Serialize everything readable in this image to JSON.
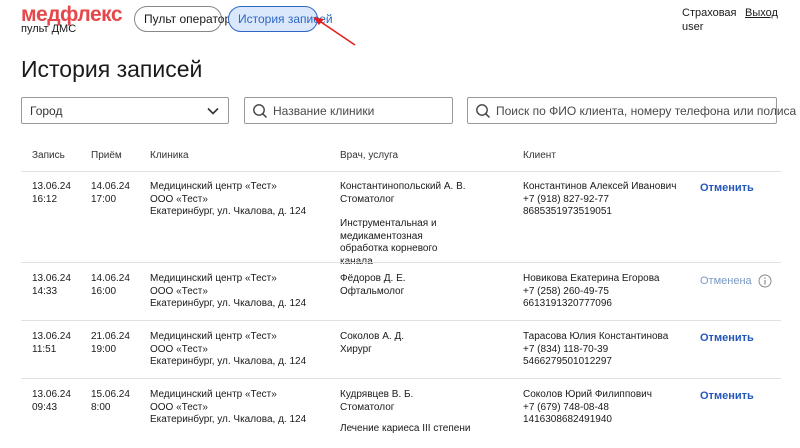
{
  "logo": {
    "main": "медфлекс",
    "sub": "пульт ДМС"
  },
  "nav": {
    "operator": "Пульт оператора",
    "history": "История записей"
  },
  "user": {
    "line1": "Страховая",
    "line2": "user",
    "logout": "Выход"
  },
  "page": {
    "title": "История записей"
  },
  "filters": {
    "city": "Город",
    "clinic_placeholder": "Название клиники",
    "search_placeholder": "Поиск по ФИО клиента, номеру телефона или полиса"
  },
  "table": {
    "headers": {
      "record": "Запись",
      "appointment": "Приём",
      "clinic": "Клиника",
      "doctor": "Врач, услуга",
      "client": "Клиент"
    },
    "rows": [
      {
        "rec_date": "13.06.24",
        "rec_time": "16:12",
        "app_date": "14.06.24",
        "app_time": "17:00",
        "clinic_name": "Медицинский центр «Тест»",
        "clinic_org": "ООО «Тест»",
        "clinic_addr": "Екатеринбург, ул. Чкалова, д. 124",
        "doctor": "Константинопольский А. В.",
        "specialty": "Стоматолог",
        "service": "Инструментальная и медикаментозная обработка корневого канала",
        "client_name": "Константинов Алексей Иванович",
        "client_phone": "+7 (918) 827-92-77",
        "client_policy": "8685351973519051",
        "action": "Отменить"
      },
      {
        "rec_date": "13.06.24",
        "rec_time": "14:33",
        "app_date": "14.06.24",
        "app_time": "16:00",
        "clinic_name": "Медицинский центр «Тест»",
        "clinic_org": "ООО «Тест»",
        "clinic_addr": "Екатеринбург, ул. Чкалова, д. 124",
        "doctor": "Фёдоров Д. Е.",
        "specialty": "Офтальмолог",
        "client_name": "Новикова Екатерина Егорова",
        "client_phone": "+7 (258) 260-49-75",
        "client_policy": "6613191320777096",
        "status": "Отменена"
      },
      {
        "rec_date": "13.06.24",
        "rec_time": "11:51",
        "app_date": "21.06.24",
        "app_time": "19:00",
        "clinic_name": "Медицинский центр «Тест»",
        "clinic_org": "ООО «Тест»",
        "clinic_addr": "Екатеринбург, ул. Чкалова, д. 124",
        "doctor": "Соколов А. Д.",
        "specialty": "Хирург",
        "client_name": "Тарасова Юлия Константинова",
        "client_phone": "+7 (834) 118-70-39",
        "client_policy": "5466279501012297",
        "action": "Отменить"
      },
      {
        "rec_date": "13.06.24",
        "rec_time": "09:43",
        "app_date": "15.06.24",
        "app_time": "8:00",
        "clinic_name": "Медицинский центр «Тест»",
        "clinic_org": "ООО «Тест»",
        "clinic_addr": "Екатеринбург, ул. Чкалова, д. 124",
        "doctor": "Кудрявцев В. Б.",
        "specialty": "Стоматолог",
        "service": "Лечение кариеса III степени",
        "client_name": "Соколов Юрий Филиппович",
        "client_phone": "+7 (679) 748-08-48",
        "client_policy": "1416308682491940",
        "action": "Отменить"
      }
    ]
  },
  "colors": {
    "brand": "#e5474b",
    "accent": "#2e67c7",
    "action": "#2458b8",
    "cancelled": "#7a99c4"
  },
  "icons": {
    "city_select": "chevron-down-icon",
    "clinic_search": "search-icon",
    "client_search": "search-icon",
    "status_info": "info-icon",
    "annotation": "red-arrow-icon"
  }
}
